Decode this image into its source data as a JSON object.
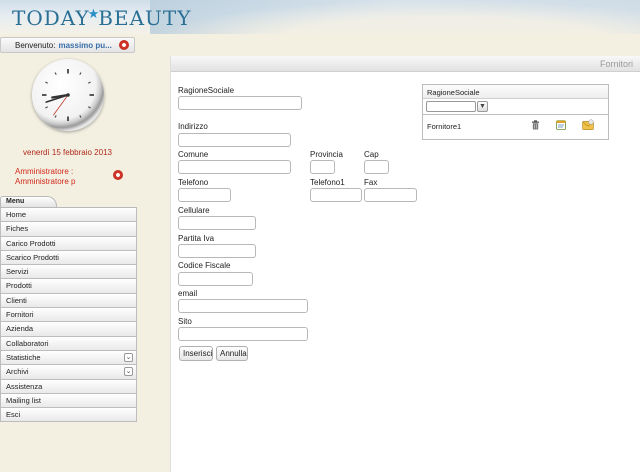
{
  "brand": {
    "logo_left": "TODAY",
    "logo_right": "BEAUTY"
  },
  "session": {
    "welcome_label": "Benvenuto:",
    "user_name": "massimo pu...",
    "date": "venerdì 15 febbraio 2013",
    "role_line1": "Amministratore :",
    "role_line2": "Amministratore p"
  },
  "clock": {
    "hour": 8,
    "minute": 42,
    "second": 36
  },
  "menu": {
    "tab_label": "Menu",
    "items": [
      {
        "label": "Home",
        "expandable": false
      },
      {
        "label": "Fiches",
        "expandable": false
      },
      {
        "label": "Carico Prodotti",
        "expandable": false
      },
      {
        "label": "Scarico Prodotti",
        "expandable": false
      },
      {
        "label": "Servizi",
        "expandable": false
      },
      {
        "label": "Prodotti",
        "expandable": false
      },
      {
        "label": "Clienti",
        "expandable": false
      },
      {
        "label": "Fornitori",
        "expandable": false
      },
      {
        "label": "Azienda",
        "expandable": false
      },
      {
        "label": "Collaboratori",
        "expandable": false
      },
      {
        "label": "Statistiche",
        "expandable": true
      },
      {
        "label": "Archivi",
        "expandable": true
      },
      {
        "label": "Assistenza",
        "expandable": false
      },
      {
        "label": "Mailing list",
        "expandable": false
      },
      {
        "label": "Esci",
        "expandable": false
      }
    ]
  },
  "page": {
    "title": "Fornitori"
  },
  "form": {
    "ragione_sociale": {
      "label": "RagioneSociale",
      "value": ""
    },
    "indirizzo": {
      "label": "Indirizzo",
      "value": ""
    },
    "comune": {
      "label": "Comune",
      "value": ""
    },
    "provincia": {
      "label": "Provincia",
      "value": ""
    },
    "cap": {
      "label": "Cap",
      "value": ""
    },
    "telefono": {
      "label": "Telefono",
      "value": ""
    },
    "telefono1": {
      "label": "Telefono1",
      "value": ""
    },
    "fax": {
      "label": "Fax",
      "value": ""
    },
    "cellulare": {
      "label": "Cellulare",
      "value": ""
    },
    "partita_iva": {
      "label": "Partita Iva",
      "value": ""
    },
    "codice_fiscale": {
      "label": "Codice Fiscale",
      "value": ""
    },
    "email": {
      "label": "email",
      "value": ""
    },
    "sito": {
      "label": "Sito",
      "value": ""
    },
    "insert_button": "Inserisci",
    "cancel_button": "Annulla"
  },
  "grid": {
    "column_header": "RagioneSociale",
    "filter_value": "",
    "rows": [
      {
        "ragione_sociale": "Fornitore1"
      }
    ]
  },
  "icons": {
    "logout": "logout-icon",
    "filter": "filter-icon",
    "delete": "trash-icon",
    "edit": "edit-icon",
    "email": "email-icon"
  }
}
